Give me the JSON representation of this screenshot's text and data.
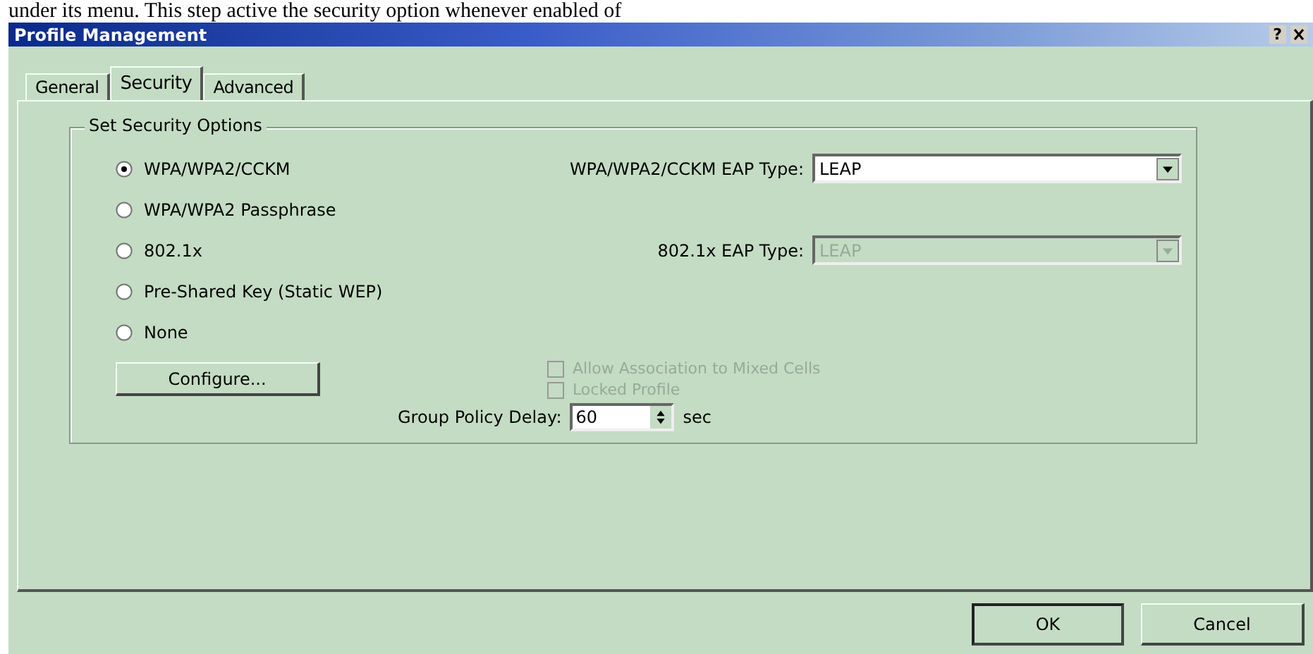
{
  "doc_caption": "under its menu. This step active the security option whenever enabled of",
  "window": {
    "title": "Profile Management",
    "help": "?"
  },
  "tabs": [
    {
      "label": "General",
      "selected": false
    },
    {
      "label": "Security",
      "selected": true
    },
    {
      "label": "Advanced",
      "selected": false
    }
  ],
  "group": {
    "title": "Set Security Options",
    "options": [
      {
        "label": "WPA/WPA2/CCKM",
        "selected": true,
        "combo": {
          "label": "WPA/WPA2/CCKM EAP Type:",
          "value": "LEAP",
          "disabled": false
        }
      },
      {
        "label": "WPA/WPA2 Passphrase",
        "selected": false
      },
      {
        "label": "802.1x",
        "selected": false,
        "combo": {
          "label": "802.1x EAP Type:",
          "value": "LEAP",
          "disabled": true
        }
      },
      {
        "label": "Pre-Shared Key (Static WEP)",
        "selected": false
      },
      {
        "label": "None",
        "selected": false
      }
    ],
    "configure": "Configure...",
    "checkboxes": [
      {
        "label": "Allow Association to Mixed Cells",
        "checked": false,
        "disabled": true
      },
      {
        "label": "Locked Profile",
        "checked": false,
        "disabled": true
      }
    ],
    "delay": {
      "label": "Group Policy Delay:",
      "value": "60",
      "unit": "sec"
    }
  },
  "buttons": [
    {
      "label": "OK",
      "default": true
    },
    {
      "label": "Cancel",
      "default": false
    }
  ]
}
